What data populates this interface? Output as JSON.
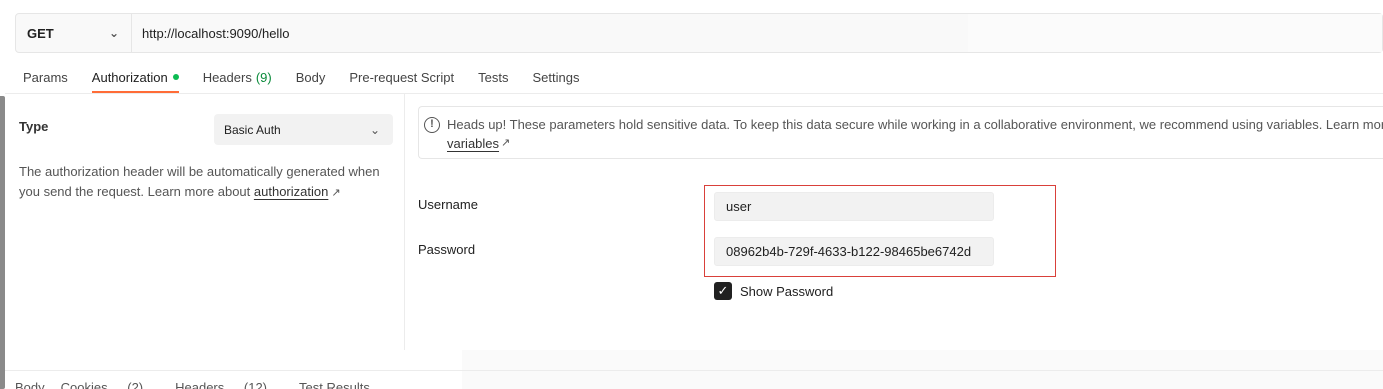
{
  "request": {
    "method": "GET",
    "url": "http://localhost:9090/hello"
  },
  "tabs": [
    {
      "label": "Params"
    },
    {
      "label": "Authorization",
      "active": true,
      "indicator": "green-dot"
    },
    {
      "label": "Headers",
      "count": "(9)"
    },
    {
      "label": "Body"
    },
    {
      "label": "Pre-request Script"
    },
    {
      "label": "Tests"
    },
    {
      "label": "Settings"
    }
  ],
  "auth": {
    "type_label": "Type",
    "type_value": "Basic Auth",
    "description": "The authorization header will be automatically generated when you send the request. Learn more about ",
    "description_link": "authorization",
    "link_icon": "arrow-up-right-icon"
  },
  "notice": {
    "icon": "info-icon",
    "text": "Heads up! These parameters hold sensitive data. To keep this data secure while working in a collaborative environment, we recommend using variables. Learn more a",
    "link": "variables"
  },
  "fields": {
    "username_label": "Username",
    "username_value": "user",
    "password_label": "Password",
    "password_value": "08962b4b-729f-4633-b122-98465be6742d",
    "show_password_label": "Show Password",
    "show_password_checked": true
  },
  "response_tabs": [
    {
      "label": "Body"
    },
    {
      "label": "Cookies",
      "count": "(2)"
    },
    {
      "label": "Headers",
      "count": "(12)"
    },
    {
      "label": "Test Results"
    }
  ],
  "colors": {
    "accent": "#ff6c37",
    "indicator": "#0cbb52",
    "highlight": "#d9403a"
  }
}
